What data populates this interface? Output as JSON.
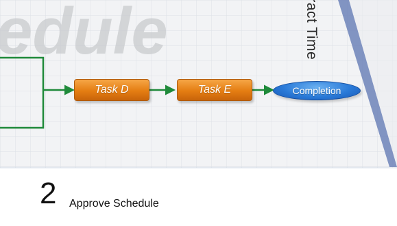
{
  "background_title": "edule",
  "contract_time_label": "tract Time",
  "nodes": [
    {
      "id": "task-d",
      "label": "Task D",
      "kind": "task"
    },
    {
      "id": "task-e",
      "label": "Task E",
      "kind": "task"
    },
    {
      "id": "completion",
      "label": "Completion",
      "kind": "milestone"
    }
  ],
  "step": {
    "number": "2",
    "label": "Approve Schedule"
  },
  "colors": {
    "task_fill": "#e47d12",
    "milestone_fill": "#2a7ad8",
    "connector": "#1f8a3a",
    "contract_line": "#6d83b8",
    "grid": "#dde1e6"
  }
}
